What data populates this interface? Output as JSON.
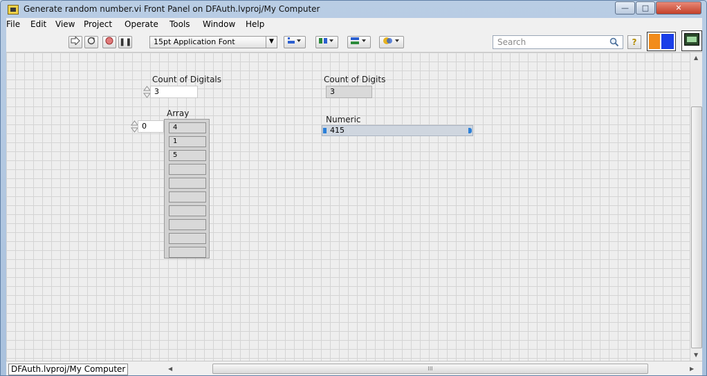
{
  "window": {
    "title": "Generate random number.vi Front Panel on DFAuth.lvproj/My Computer",
    "controls": {
      "minimize": "—",
      "maximize": "□",
      "close": "✕"
    }
  },
  "menu": [
    "File",
    "Edit",
    "View",
    "Project",
    "Operate",
    "Tools",
    "Window",
    "Help"
  ],
  "toolbar": {
    "font": "15pt Application Font",
    "search_placeholder": "Search",
    "icons": [
      "run-arrow-icon",
      "run-continuously-icon",
      "abort-icon",
      "pause-icon",
      "align-objects-icon",
      "distribute-objects-icon",
      "resize-objects-icon",
      "reorder-icon",
      "search-icon",
      "help-icon",
      "connector-pane-icon",
      "vi-icon"
    ]
  },
  "panel": {
    "count_of_digitals": {
      "label": "Count of Digitals",
      "value": "3"
    },
    "count_of_digits": {
      "label": "Count of Digits",
      "value": "3"
    },
    "array": {
      "label": "Array",
      "index": "0",
      "values": [
        "4",
        "1",
        "5",
        "",
        "",
        "",
        "",
        "",
        "",
        ""
      ]
    },
    "numeric": {
      "label": "Numeric",
      "value": "415"
    }
  },
  "statusbar": {
    "context": "DFAuth.lvproj/My Computer",
    "scroll_grip": "III"
  },
  "colors": {
    "panel_bg": "#eeeeee",
    "grid_line": "#d4d4d4",
    "indicator_bg": "#d9d9d9",
    "numeric_bar": "#cfd6df",
    "accent_blue": "#2c80d8",
    "connector_orange": "#f28c1b",
    "connector_blue": "#1a3fe8"
  }
}
